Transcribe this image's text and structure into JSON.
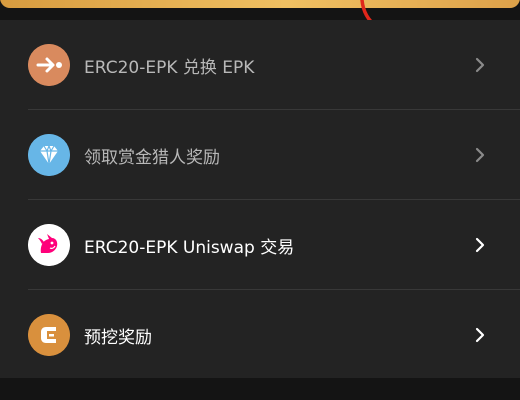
{
  "menu": {
    "items": [
      {
        "label": "ERC20-EPK 兑换 EPK",
        "icon": "exchange-arrow-icon",
        "color": "#d98a5e",
        "enabled": false
      },
      {
        "label": "领取赏金猎人奖励",
        "icon": "diamond-icon",
        "color": "#67b6e7",
        "enabled": false
      },
      {
        "label": "ERC20-EPK Uniswap 交易",
        "icon": "uniswap-unicorn-icon",
        "color": "#ff007a",
        "enabled": true
      },
      {
        "label": "预挖奖励",
        "icon": "epk-coin-icon",
        "color": "#d9903d",
        "enabled": true
      }
    ]
  },
  "colors": {
    "background": "#141414",
    "card": "#232323",
    "accent_gold": "#f0c062",
    "annotation_red": "#e0261b"
  }
}
